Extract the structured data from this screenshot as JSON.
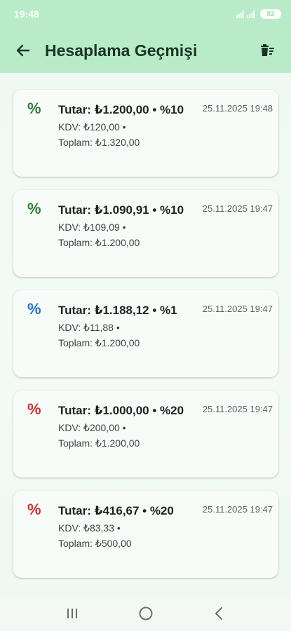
{
  "status_bar": {
    "time": "19:48",
    "battery": "82"
  },
  "app_bar": {
    "title": "Hesaplama Geçmişi"
  },
  "history": [
    {
      "main": "Tutar: ₺1.200,00 • %10",
      "kdv": "KDV: ₺120,00 •",
      "total": "Toplam: ₺1.320,00",
      "date": "25.11.2025 19:48",
      "icon_color": "#2e7d32",
      "icon": "percent-icon"
    },
    {
      "main": "Tutar: ₺1.090,91 • %10",
      "kdv": "KDV: ₺109,09 •",
      "total": "Toplam: ₺1.200,00",
      "date": "25.11.2025 19:47",
      "icon_color": "#2e7d32",
      "icon": "percent-icon"
    },
    {
      "main": "Tutar: ₺1.188,12 • %1",
      "kdv": "KDV: ₺11,88 •",
      "total": "Toplam: ₺1.200,00",
      "date": "25.11.2025 19:47",
      "icon_color": "#1e6fd0",
      "icon": "percent-icon"
    },
    {
      "main": "Tutar: ₺1.000,00 • %20",
      "kdv": "KDV: ₺200,00 •",
      "total": "Toplam: ₺1.200,00",
      "date": "25.11.2025 19:47",
      "icon_color": "#d32f2f",
      "icon": "percent-icon"
    },
    {
      "main": "Tutar: ₺416,67 • %20",
      "kdv": "KDV: ₺83,33 •",
      "total": "Toplam: ₺500,00",
      "date": "25.11.2025 19:47",
      "icon_color": "#d32f2f",
      "icon": "percent-icon"
    }
  ],
  "icons": {
    "back": "arrow-left-icon",
    "clear": "delete-sweep-icon",
    "nav_recent": "recents-icon",
    "nav_home": "home-icon",
    "nav_back": "chevron-left-icon"
  },
  "colors": {
    "app_bar": "#b8ecc9",
    "background": "#eef8f1",
    "card": "#f7fcf9"
  }
}
